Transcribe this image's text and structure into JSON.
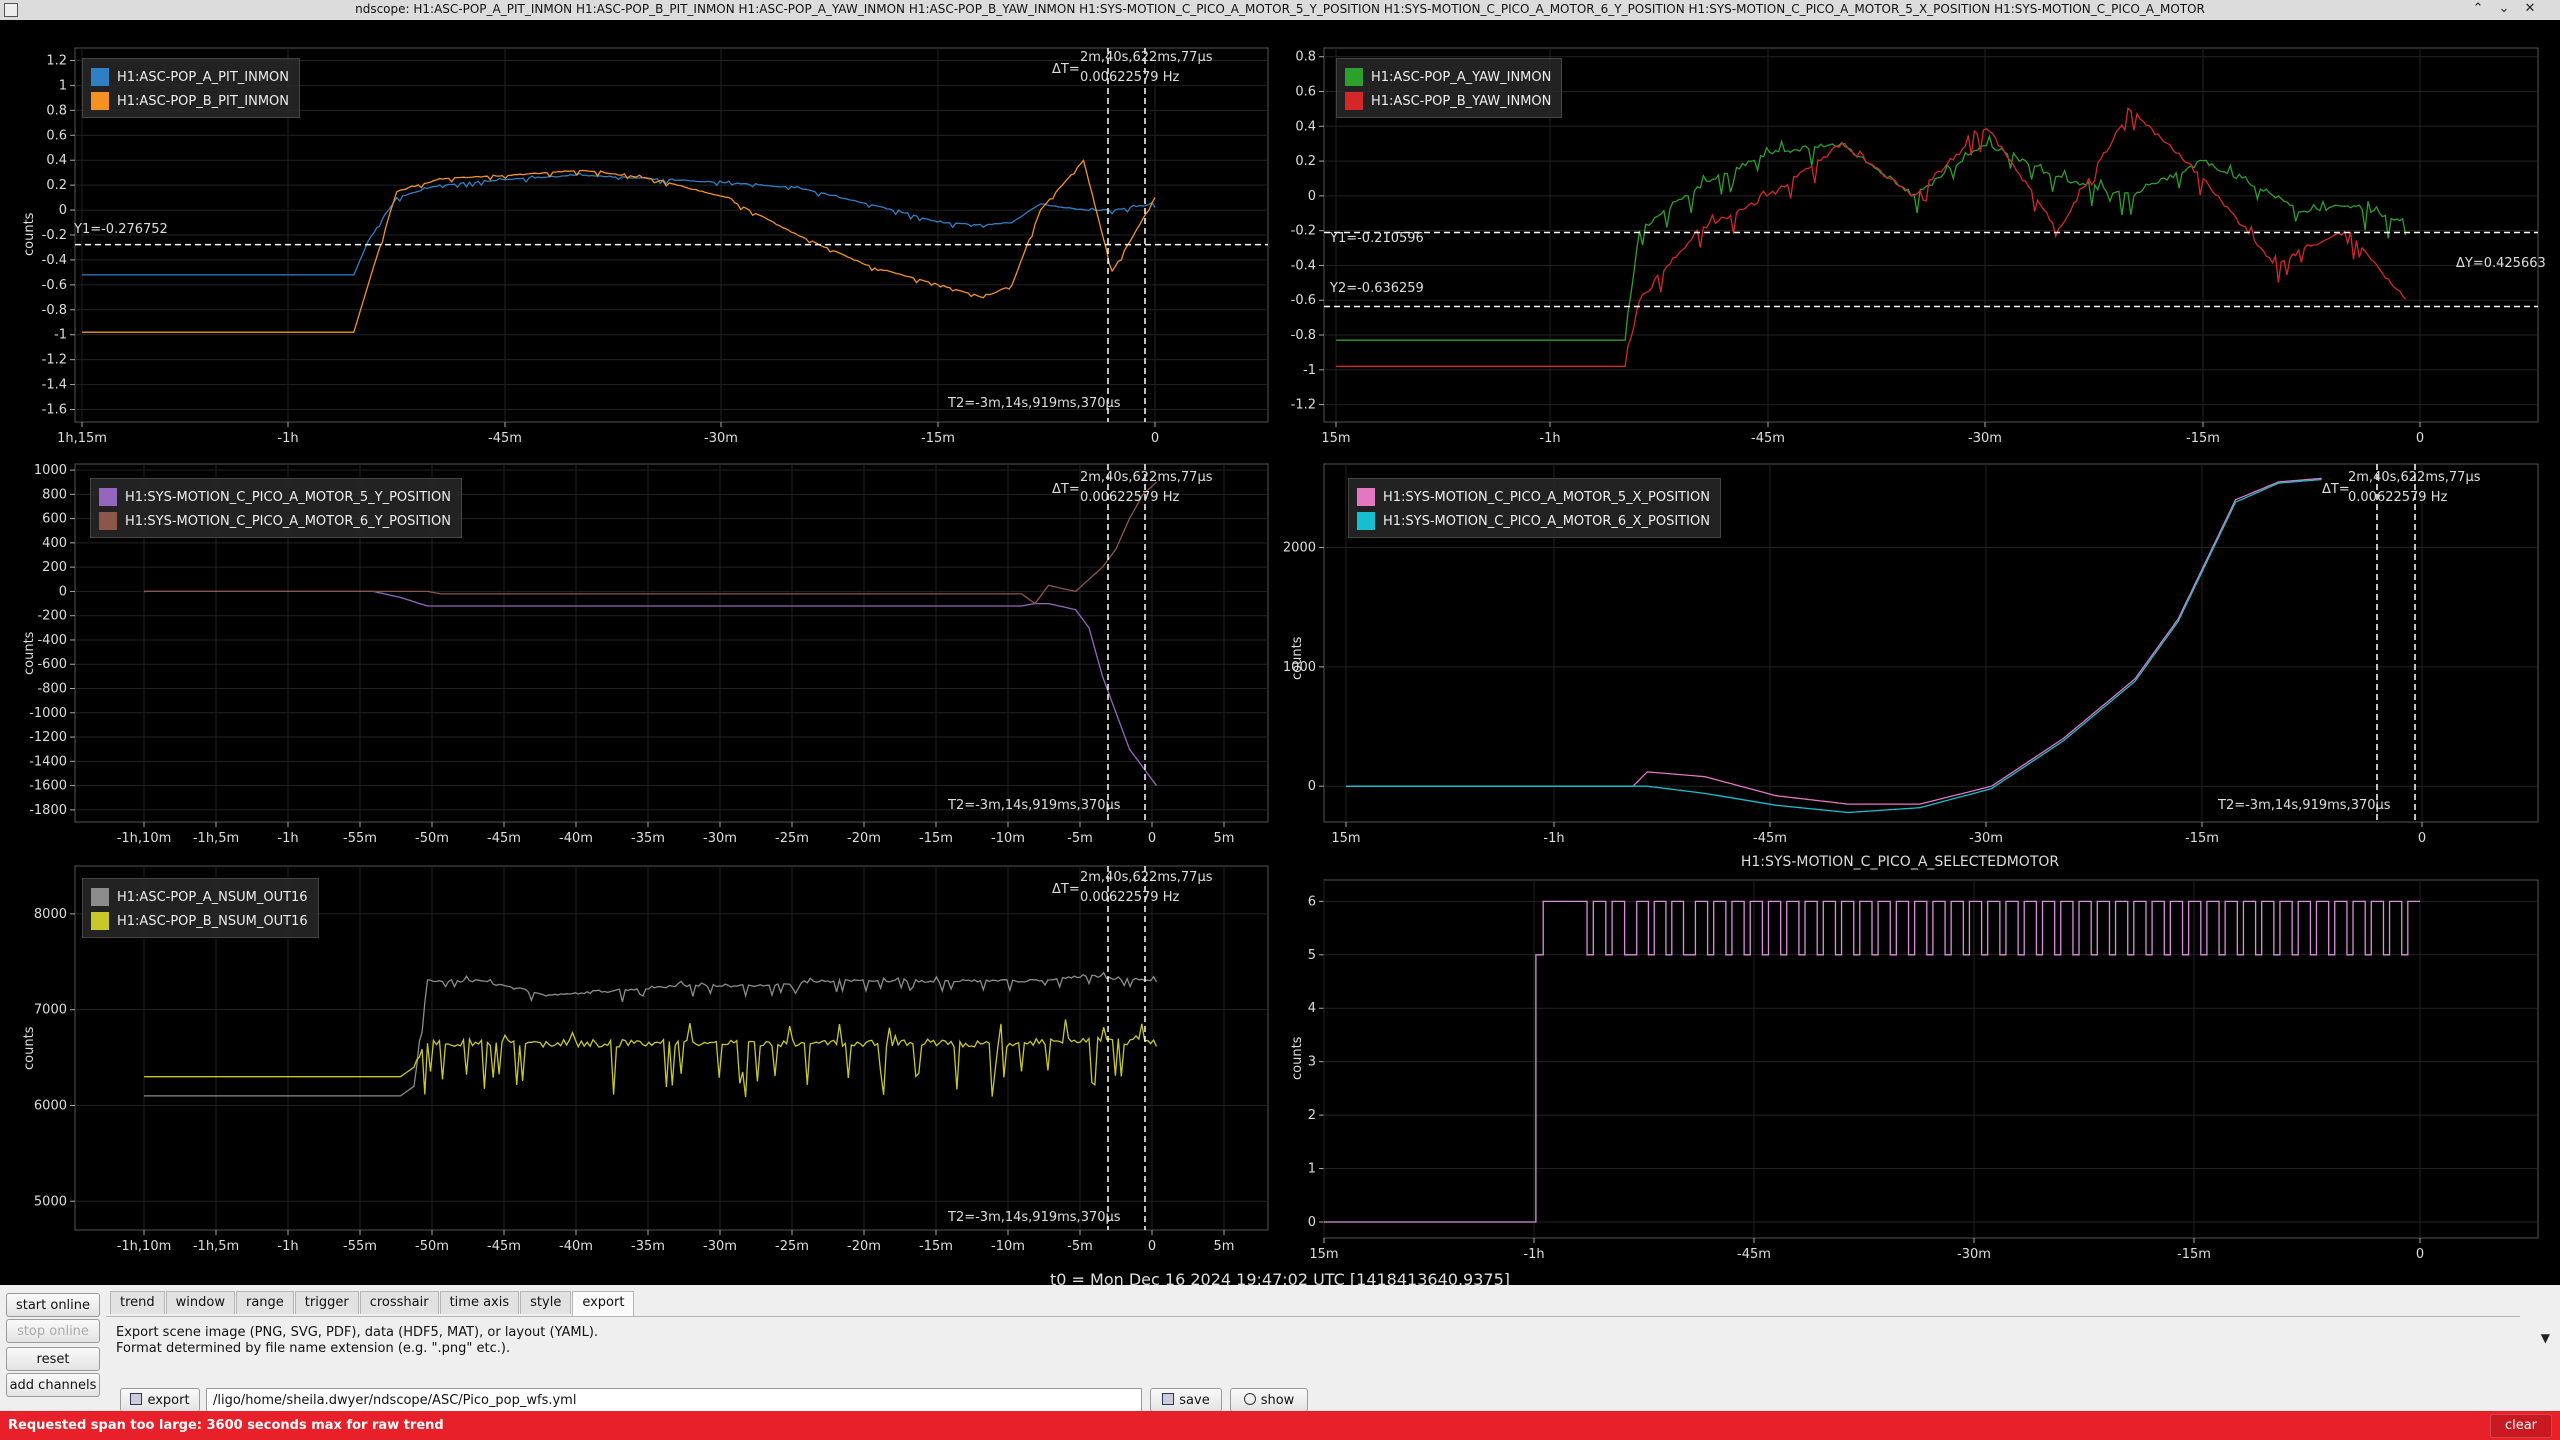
{
  "window": {
    "title": "ndscope: H1:ASC-POP_A_PIT_INMON H1:ASC-POP_B_PIT_INMON H1:ASC-POP_A_YAW_INMON H1:ASC-POP_B_YAW_INMON H1:SYS-MOTION_C_PICO_A_MOTOR_5_Y_POSITION H1:SYS-MOTION_C_PICO_A_MOTOR_6_Y_POSITION H1:SYS-MOTION_C_PICO_A_MOTOR_5_X_POSITION H1:SYS-MOTION_C_PICO_A_MOTOR",
    "controls": {
      "minimize": "⌃",
      "maximize": "⌄",
      "close": "✕"
    }
  },
  "plots": {
    "p1": {
      "ylabel": "counts",
      "legend": [
        {
          "name": "H1:ASC-POP_A_PIT_INMON",
          "color": "#2f7fc4"
        },
        {
          "name": "H1:ASC-POP_B_PIT_INMON",
          "color": "#f39223"
        }
      ],
      "cursor_dt": "ΔT=",
      "cursor_dt_value": "2m,40s,622ms,77μs",
      "cursor_freq": "0.00622579 Hz",
      "cursor_t2": "T2=-3m,14s,919ms,370μs",
      "cursor_y1": "Y1=-0.276752"
    },
    "p2": {
      "legend": [
        {
          "name": "H1:ASC-POP_A_YAW_INMON",
          "color": "#2ca02c"
        },
        {
          "name": "H1:ASC-POP_B_YAW_INMON",
          "color": "#d62728"
        }
      ],
      "cursor_y1": "Y1=-0.210596",
      "cursor_y2": "Y2=-0.636259",
      "cursor_dy": "ΔY=0.425663"
    },
    "p3": {
      "ylabel": "counts",
      "legend": [
        {
          "name": "H1:SYS-MOTION_C_PICO_A_MOTOR_5_Y_POSITION",
          "color": "#9467bd"
        },
        {
          "name": "H1:SYS-MOTION_C_PICO_A_MOTOR_6_Y_POSITION",
          "color": "#8c564b"
        }
      ],
      "cursor_dt": "ΔT=",
      "cursor_dt_value": "2m,40s,622ms,77μs",
      "cursor_freq": "0.00622579 Hz",
      "cursor_t2": "T2=-3m,14s,919ms,370μs"
    },
    "p4": {
      "ylabel": "counts",
      "legend": [
        {
          "name": "H1:SYS-MOTION_C_PICO_A_MOTOR_5_X_POSITION",
          "color": "#e377c2"
        },
        {
          "name": "H1:SYS-MOTION_C_PICO_A_MOTOR_6_X_POSITION",
          "color": "#17becf"
        }
      ],
      "cursor_dt": "ΔT=",
      "cursor_dt_value": "2m,40s,622ms,77μs",
      "cursor_freq": "0.00622579 Hz",
      "cursor_t2": "T2=-3m,14s,919ms,370μs"
    },
    "p5": {
      "ylabel": "counts",
      "legend": [
        {
          "name": "H1:ASC-POP_A_NSUM_OUT16",
          "color": "#8c8c8c"
        },
        {
          "name": "H1:ASC-POP_B_NSUM_OUT16",
          "color": "#c8c828"
        }
      ],
      "cursor_dt": "ΔT=",
      "cursor_dt_value": "2m,40s,622ms,77μs",
      "cursor_freq": "0.00622579 Hz",
      "cursor_t2": "T2=-3m,14s,919ms,370μs"
    },
    "p6": {
      "title": "H1:SYS-MOTION_C_PICO_A_SELECTEDMOTOR",
      "ylabel": "counts",
      "series_color": "#d98fd9"
    }
  },
  "chart_data": [
    {
      "type": "line",
      "ylabel": "counts",
      "x_ticks": [
        "1h,15m",
        "-1h",
        "-45m",
        "-30m",
        "-15m",
        "0"
      ],
      "y_ticks": [
        "1.2",
        "1",
        "0.8",
        "0.6",
        "0.4",
        "0.2",
        "0",
        "-0.2",
        "-0.4",
        "-0.6",
        "-0.8",
        "-1",
        "-1.2",
        "-1.4",
        "-1.6"
      ],
      "ylim": [
        -1.7,
        1.3
      ],
      "xlim_min": [
        -75,
        8
      ],
      "series": [
        {
          "name": "H1:ASC-POP_A_PIT_INMON",
          "x": [
            -75,
            -56,
            -55,
            -53,
            -50,
            -45,
            -40,
            -35,
            -30,
            -25,
            -20,
            -15,
            -12,
            -10,
            -8,
            -5,
            -3,
            0
          ],
          "y": [
            -0.52,
            -0.52,
            -0.25,
            0.1,
            0.2,
            0.25,
            0.28,
            0.25,
            0.22,
            0.18,
            0.05,
            -0.1,
            -0.12,
            -0.1,
            0.05,
            0.0,
            0.0,
            0.05
          ]
        },
        {
          "name": "H1:ASC-POP_B_PIT_INMON",
          "x": [
            -75,
            -56,
            -55,
            -53,
            -50,
            -45,
            -40,
            -35,
            -30,
            -25,
            -20,
            -15,
            -12,
            -10,
            -8,
            -5,
            -3,
            0
          ],
          "y": [
            -0.98,
            -0.98,
            -0.6,
            0.15,
            0.25,
            0.28,
            0.32,
            0.25,
            0.1,
            -0.2,
            -0.45,
            -0.6,
            -0.7,
            -0.6,
            0.0,
            0.4,
            -0.5,
            0.1
          ]
        }
      ]
    },
    {
      "type": "line",
      "x_ticks": [
        "15m",
        "-1h",
        "-45m",
        "-30m",
        "-15m",
        "0"
      ],
      "y_ticks": [
        "0.8",
        "0.6",
        "0.4",
        "0.2",
        "0",
        "-0.2",
        "-0.4",
        "-0.6",
        "-0.8",
        "-1",
        "-1.2"
      ],
      "ylim": [
        -1.3,
        0.85
      ],
      "xlim_min": [
        -75,
        8
      ],
      "series": [
        {
          "name": "H1:ASC-POP_A_YAW_INMON",
          "x": [
            -75,
            -55,
            -54,
            -50,
            -45,
            -40,
            -35,
            -30,
            -25,
            -20,
            -15,
            -10,
            -8,
            -5,
            -3,
            -1
          ],
          "y": [
            -0.83,
            -0.83,
            -0.2,
            0.05,
            0.25,
            0.3,
            0.0,
            0.3,
            0.1,
            0.0,
            0.2,
            0.0,
            -0.1,
            -0.05,
            -0.1,
            -0.15
          ]
        },
        {
          "name": "H1:ASC-POP_B_YAW_INMON",
          "x": [
            -75,
            -55,
            -54,
            -50,
            -45,
            -40,
            -35,
            -30,
            -25,
            -20,
            -15,
            -10,
            -8,
            -5,
            -3,
            -1
          ],
          "y": [
            -0.98,
            -0.98,
            -0.6,
            -0.2,
            0.0,
            0.3,
            0.0,
            0.4,
            -0.2,
            0.5,
            0.1,
            -0.4,
            -0.3,
            -0.2,
            -0.4,
            -0.6
          ]
        }
      ]
    },
    {
      "type": "line",
      "ylabel": "counts",
      "x_ticks": [
        "-1h,10m",
        "-1h,5m",
        "-1h",
        "-55m",
        "-50m",
        "-45m",
        "-40m",
        "-35m",
        "-30m",
        "-25m",
        "-20m",
        "-15m",
        "-10m",
        "-5m",
        "0",
        "5m"
      ],
      "y_ticks": [
        "1000",
        "800",
        "600",
        "400",
        "200",
        "0",
        "-200",
        "-400",
        "-600",
        "-800",
        "-1000",
        "-1200",
        "-1400",
        "-1600",
        "-1800"
      ],
      "ylim": [
        -1900,
        1050
      ],
      "xlim_min": [
        -75,
        8
      ],
      "series": [
        {
          "name": "H1:SYS-MOTION_C_PICO_A_MOTOR_5_Y_POSITION",
          "x": [
            -75,
            -58,
            -56,
            -54,
            -10,
            -9,
            -8,
            -6,
            -5,
            -4,
            -3,
            -2,
            -1,
            0
          ],
          "y": [
            0,
            0,
            -50,
            -120,
            -120,
            -100,
            -100,
            -150,
            -300,
            -700,
            -1000,
            -1300,
            -1450,
            -1600
          ]
        },
        {
          "name": "H1:SYS-MOTION_C_PICO_A_MOTOR_6_Y_POSITION",
          "x": [
            -75,
            -54,
            -53,
            -10,
            -9,
            -8,
            -6,
            -5,
            -4,
            -3,
            -2,
            -1,
            0
          ],
          "y": [
            0,
            0,
            -20,
            -20,
            -100,
            50,
            0,
            100,
            200,
            350,
            600,
            800,
            900
          ]
        }
      ]
    },
    {
      "type": "line",
      "ylabel": "counts",
      "x_ticks": [
        "15m",
        "-1h",
        "-45m",
        "-30m",
        "-15m",
        "0"
      ],
      "y_ticks": [
        "2000",
        "1000",
        "0"
      ],
      "ylim": [
        -300,
        2700
      ],
      "xlim_min": [
        -75,
        8
      ],
      "series": [
        {
          "name": "H1:SYS-MOTION_C_PICO_A_MOTOR_5_X_POSITION",
          "x": [
            -75,
            -55,
            -54,
            -50,
            -45,
            -40,
            -35,
            -30,
            -25,
            -20,
            -17,
            -15,
            -13,
            -10,
            -7
          ],
          "y": [
            0,
            0,
            120,
            80,
            -80,
            -150,
            -150,
            0,
            400,
            900,
            1400,
            1900,
            2400,
            2550,
            2580
          ]
        },
        {
          "name": "H1:SYS-MOTION_C_PICO_A_MOTOR_6_X_POSITION",
          "x": [
            -75,
            -55,
            -54,
            -50,
            -45,
            -40,
            -35,
            -30,
            -25,
            -20,
            -17,
            -15,
            -13,
            -10,
            -7
          ],
          "y": [
            0,
            0,
            0,
            -60,
            -160,
            -220,
            -180,
            -20,
            380,
            880,
            1380,
            1880,
            2380,
            2540,
            2570
          ]
        }
      ]
    },
    {
      "type": "line",
      "ylabel": "counts",
      "x_ticks": [
        "-1h,10m",
        "-1h,5m",
        "-1h",
        "-55m",
        "-50m",
        "-45m",
        "-40m",
        "-35m",
        "-30m",
        "-25m",
        "-20m",
        "-15m",
        "-10m",
        "-5m",
        "0",
        "5m"
      ],
      "y_ticks": [
        "8000",
        "7000",
        "6000",
        "5000"
      ],
      "ylim": [
        4700,
        8500
      ],
      "xlim_min": [
        -75,
        8
      ],
      "series": [
        {
          "name": "H1:ASC-POP_A_NSUM_OUT16",
          "x": [
            -75,
            -56,
            -55,
            -54,
            -50,
            -45,
            -40,
            -35,
            -30,
            -25,
            -20,
            -15,
            -10,
            -5,
            0
          ],
          "y": [
            6100,
            6100,
            6200,
            7300,
            7300,
            7150,
            7200,
            7250,
            7250,
            7300,
            7300,
            7300,
            7300,
            7350,
            7300
          ]
        },
        {
          "name": "H1:ASC-POP_B_NSUM_OUT16",
          "x": [
            -75,
            -56,
            -55,
            -54,
            -50,
            -45,
            -40,
            -35,
            -30,
            -25,
            -20,
            -15,
            -10,
            -5,
            0
          ],
          "y": [
            6300,
            6300,
            6400,
            6650,
            6650,
            6650,
            6650,
            6650,
            6650,
            6650,
            6650,
            6650,
            6650,
            6700,
            6650
          ]
        }
      ]
    },
    {
      "type": "line",
      "title": "H1:SYS-MOTION_C_PICO_A_SELECTEDMOTOR",
      "ylabel": "counts",
      "x_ticks": [
        "15m",
        "-1h",
        "-45m",
        "-30m",
        "-15m",
        "0"
      ],
      "y_ticks": [
        "6",
        "5",
        "4",
        "3",
        "2",
        "1",
        "0"
      ],
      "ylim": [
        -0.3,
        6.4
      ],
      "xlim_min": [
        -75,
        1
      ],
      "series": [
        {
          "name": "H1:SYS-MOTION_C_PICO_A_SELECTEDMOTOR",
          "x": [
            -75,
            -61,
            -60.5,
            -60,
            -57,
            -54,
            -50,
            -45,
            -40,
            -35,
            -30,
            -25,
            -20,
            -15,
            -10,
            -5,
            0
          ],
          "y": [
            0,
            0,
            5,
            6,
            5,
            6,
            5,
            6,
            5,
            6,
            5,
            6,
            5,
            6,
            5,
            6,
            6
          ]
        }
      ]
    }
  ],
  "timeline": {
    "t0": "t0 = Mon Dec 16 2024 19:47:02 UTC [1418413640.9375]"
  },
  "sidebar": {
    "start_online": "start online",
    "stop_online": "stop online",
    "reset": "reset",
    "add_channels": "add channels"
  },
  "tabs": [
    "trend",
    "window",
    "range",
    "trigger",
    "crosshair",
    "time axis",
    "style",
    "export"
  ],
  "export": {
    "desc1": "Export scene image (PNG, SVG, PDF), data (HDF5, MAT), or layout (YAML).",
    "desc2": "Format determined by file name extension (e.g. \".png\" etc.).",
    "export_label": "export",
    "path": "/ligo/home/sheila.dwyer/ndscope/ASC/Pico_pop_wfs.yml",
    "save_label": "save",
    "show_label": "show"
  },
  "status": {
    "message": "Requested span too large: 3600 seconds max for raw trend",
    "clear_label": "clear"
  },
  "colors": {
    "status_red": "#e8202a",
    "background": "#000000"
  }
}
